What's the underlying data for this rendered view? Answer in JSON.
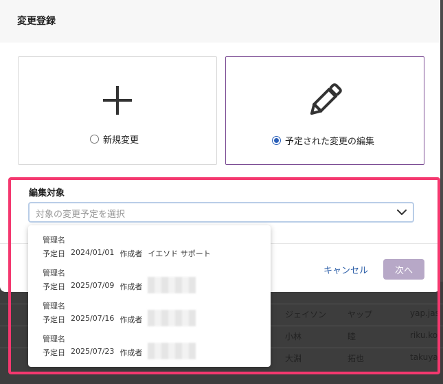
{
  "dialog": {
    "title": "変更登録",
    "option_new": "新規変更",
    "option_edit": "予定された変更の編集",
    "selected_option": "edit",
    "edit_target_label": "編集対象",
    "select_placeholder": "対象の変更予定を選択",
    "cancel_label": "キャンセル",
    "next_label": "次へ"
  },
  "dropdown_options": [
    {
      "name": "管理名",
      "date_label": "予定日",
      "date": "2024/01/01",
      "author_label": "作成者",
      "author": "イエソド サポート"
    },
    {
      "name": "管理名",
      "date_label": "予定日",
      "date": "2025/07/09",
      "author_label": "作成者",
      "author": ""
    },
    {
      "name": "管理名",
      "date_label": "予定日",
      "date": "2025/07/16",
      "author_label": "作成者",
      "author": ""
    },
    {
      "name": "管理名",
      "date_label": "予定日",
      "date": "2025/07/23",
      "author_label": "作成者",
      "author": ""
    }
  ],
  "background_table": {
    "rows": [
      [
        "ジェイソン",
        "ヤップ",
        "yap.jas"
      ],
      [
        "小林",
        "睦",
        "riku.ko"
      ],
      [
        "大淵",
        "拓也",
        "takuya"
      ]
    ]
  },
  "colors": {
    "selected_border": "#7b4c94",
    "radio_checked": "#2a5fb8",
    "highlight": "#f4386f",
    "next_button_bg": "#b7a8c7",
    "cancel_text": "#2d5fa8"
  }
}
